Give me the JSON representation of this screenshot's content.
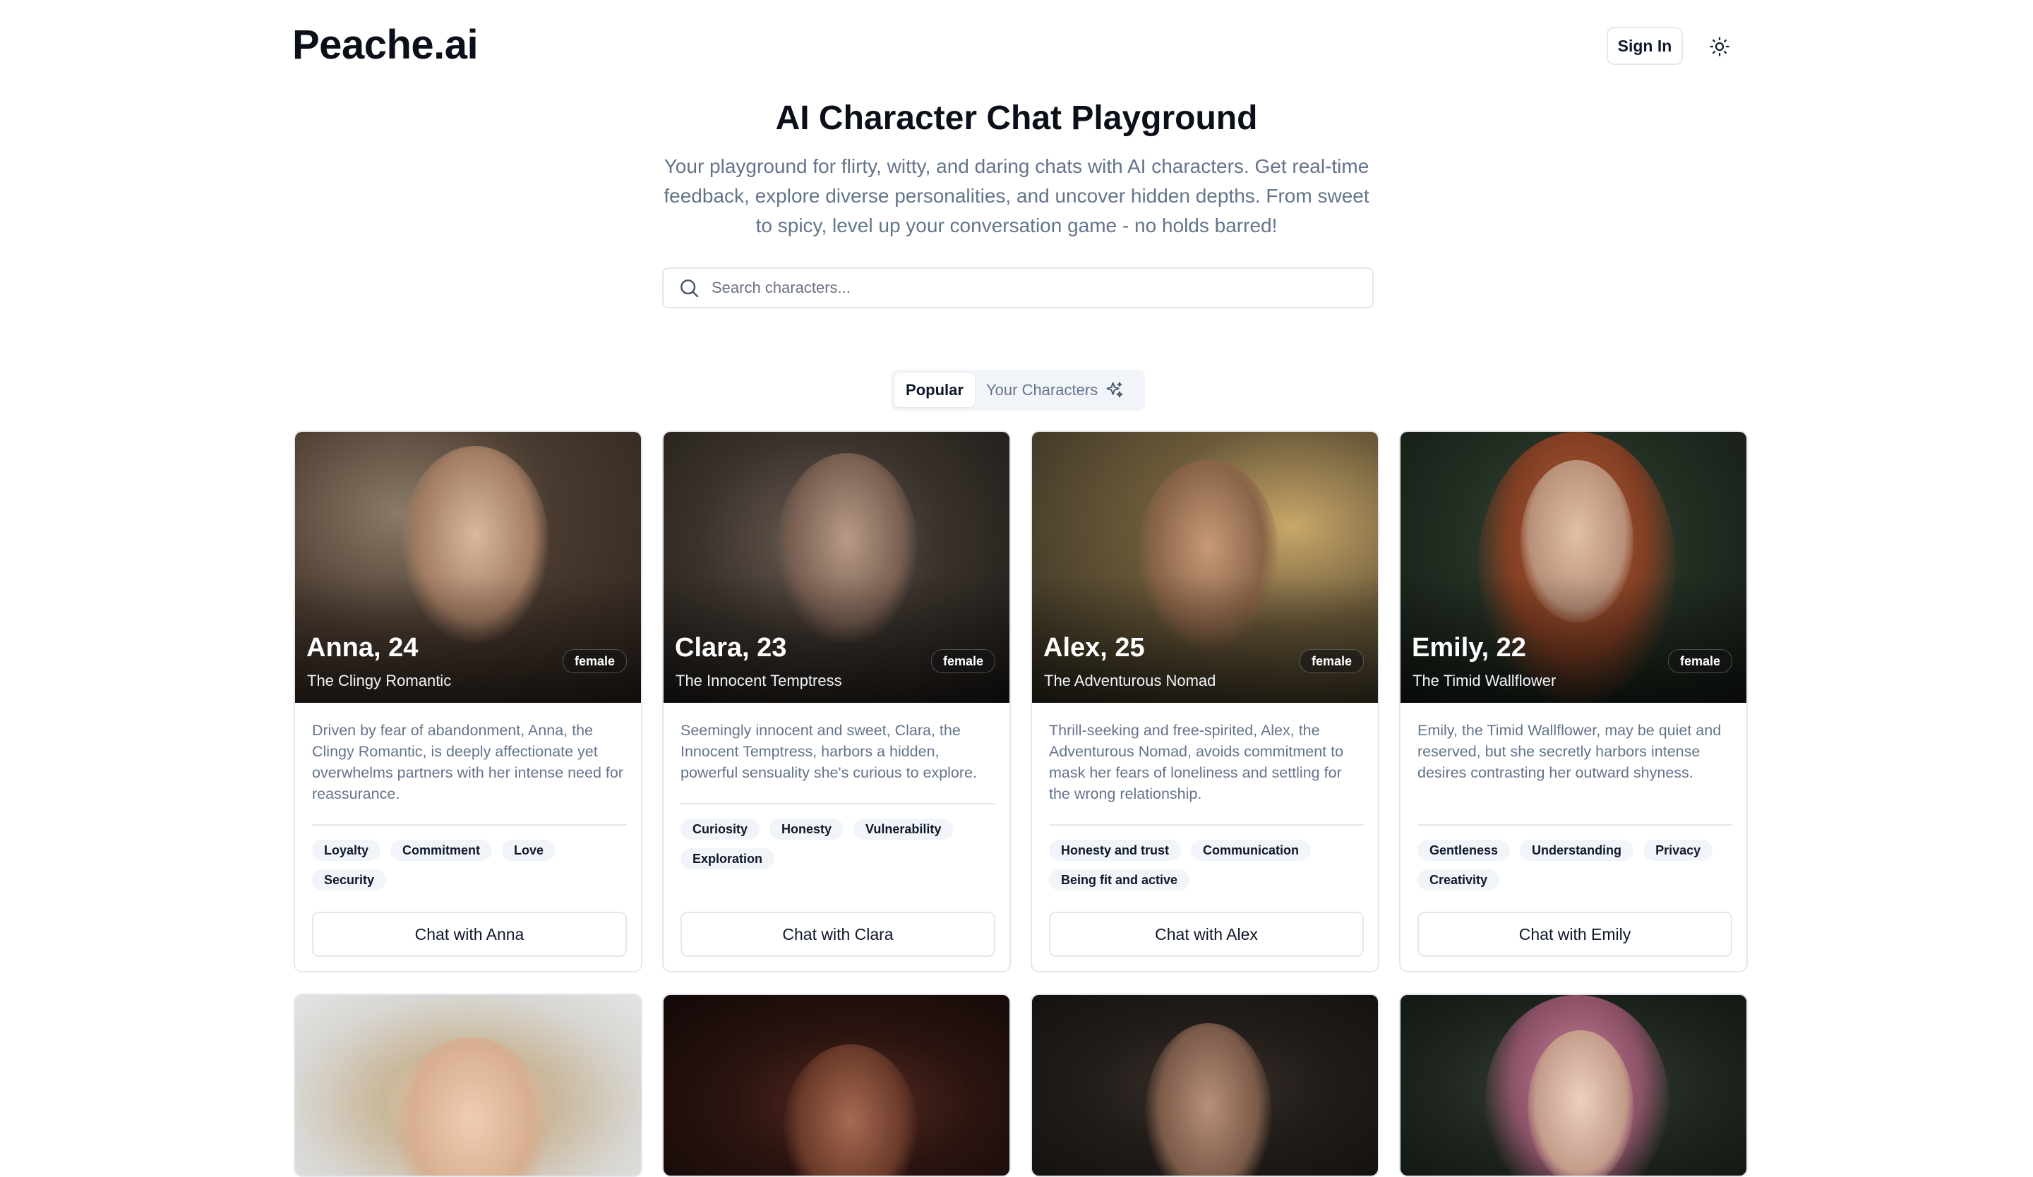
{
  "brand": "Peache.ai",
  "header": {
    "signin_label": "Sign In"
  },
  "hero": {
    "title": "AI Character Chat Playground",
    "subtitle": "Your playground for flirty, witty, and daring chats with AI characters. Get real-time feedback, explore diverse personalities, and uncover hidden depths. From sweet to spicy, level up your conversation game - no holds barred!"
  },
  "search": {
    "placeholder": "Search characters..."
  },
  "tabs": [
    {
      "label": "Popular",
      "active": true
    },
    {
      "label": "Your Characters",
      "icon": "sparkles-icon"
    }
  ],
  "characters": [
    {
      "name": "Anna, 24",
      "role": "The Clingy Romantic",
      "gender": "female",
      "description": "Driven by fear of abandonment, Anna, the Clingy Romantic, is deeply affectionate yet overwhelms partners with her intense need for reassurance.",
      "tags": [
        "Loyalty",
        "Commitment",
        "Love",
        "Security"
      ],
      "cta": "Chat with Anna"
    },
    {
      "name": "Clara, 23",
      "role": "The Innocent Temptress",
      "gender": "female",
      "description": "Seemingly innocent and sweet, Clara, the Innocent Temptress, harbors a hidden, powerful sensuality she's curious to explore.",
      "tags": [
        "Curiosity",
        "Honesty",
        "Vulnerability",
        "Exploration"
      ],
      "cta": "Chat with Clara"
    },
    {
      "name": "Alex, 25",
      "role": "The Adventurous Nomad",
      "gender": "female",
      "description": "Thrill-seeking and free-spirited, Alex, the Adventurous Nomad, avoids commitment to mask her fears of loneliness and settling for the wrong relationship.",
      "tags": [
        "Honesty and trust",
        "Communication",
        "Being fit and active"
      ],
      "cta": "Chat with Alex"
    },
    {
      "name": "Emily, 22",
      "role": "The Timid Wallflower",
      "gender": "female",
      "description": "Emily, the Timid Wallflower, may be quiet and reserved, but she secretly harbors intense desires contrasting her outward shyness.",
      "tags": [
        "Gentleness",
        "Understanding",
        "Privacy",
        "Creativity"
      ],
      "cta": "Chat with Emily"
    }
  ]
}
